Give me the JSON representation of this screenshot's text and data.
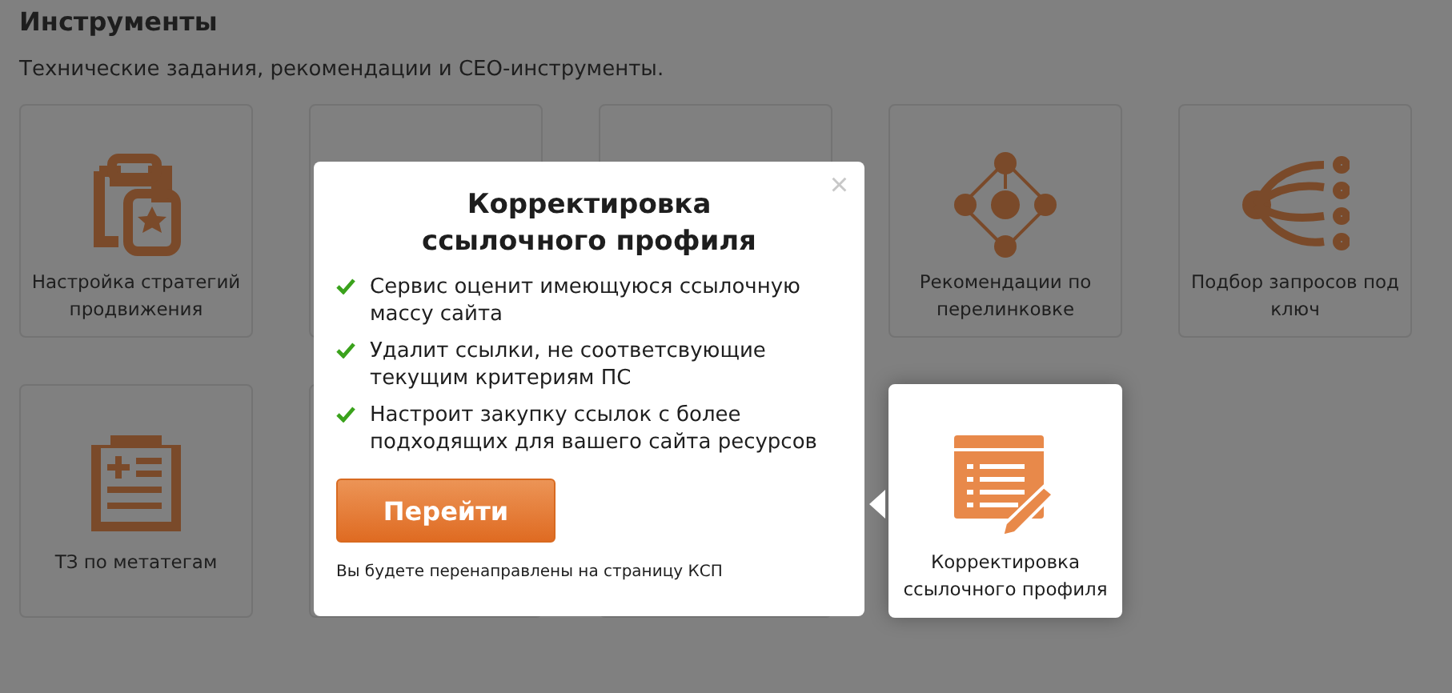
{
  "section": {
    "title": "Инструменты",
    "subtitle": "Технические задания, рекомендации и СЕО-инструменты."
  },
  "tiles": [
    {
      "label": "Настройка стратегий продвижения",
      "selected": false
    },
    {
      "selected": false
    },
    {
      "selected": false
    },
    {
      "label": "Рекомендации по перелинковке",
      "selected": false
    },
    {
      "label": "Подбор запросов под ключ",
      "selected": false
    },
    {
      "label": "ТЗ по метатегам",
      "selected": false
    },
    {
      "selected": false
    },
    {
      "selected": false
    },
    {
      "label": "Корректировка ссылочного профиля",
      "selected": true
    }
  ],
  "popup": {
    "close": "×",
    "title": "Корректировка ссылочного профиля",
    "features": [
      "Сервис оценит имеющуюся ссылочную массу сайта",
      "Удалит ссылки, не соответсвующие текущим критериям ПС",
      "Настроит закупку ссылок с более подходящих для вашего сайта ресурсов"
    ],
    "button": "Перейти",
    "note": "Вы будете перенаправлены на страницу КСП"
  }
}
